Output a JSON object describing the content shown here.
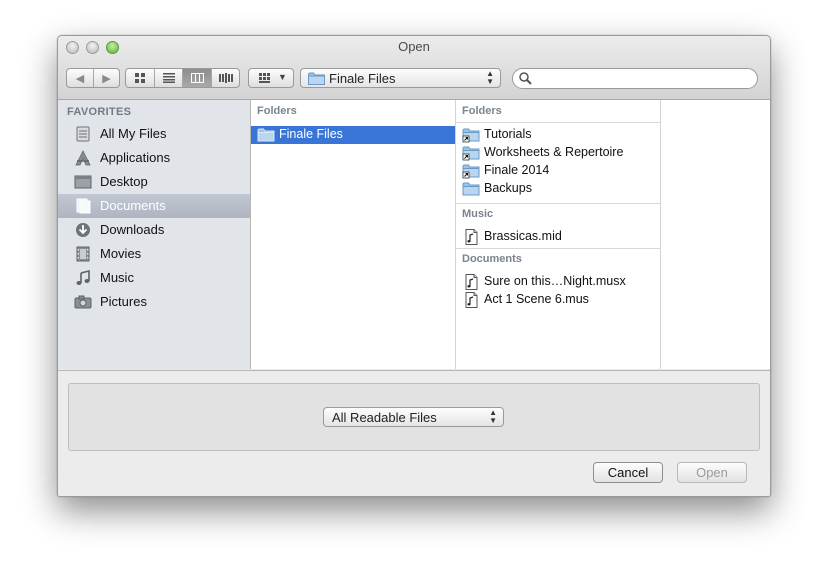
{
  "window": {
    "title": "Open"
  },
  "toolbar": {
    "back_icon": "chevron-left-icon",
    "forward_icon": "chevron-right-icon",
    "views": [
      "icon-view",
      "list-view",
      "column-view",
      "coverflow-view"
    ],
    "active_view": "column-view",
    "arrange_icon": "arrange-grid-icon",
    "path_popup": "Finale Files",
    "search_placeholder": ""
  },
  "sidebar": {
    "heading": "FAVORITES",
    "items": [
      {
        "label": "All My Files",
        "icon": "all-files-icon"
      },
      {
        "label": "Applications",
        "icon": "applications-icon"
      },
      {
        "label": "Desktop",
        "icon": "desktop-icon"
      },
      {
        "label": "Documents",
        "icon": "documents-icon",
        "selected": true
      },
      {
        "label": "Downloads",
        "icon": "downloads-icon"
      },
      {
        "label": "Movies",
        "icon": "movies-icon"
      },
      {
        "label": "Music",
        "icon": "music-icon"
      },
      {
        "label": "Pictures",
        "icon": "pictures-icon"
      }
    ]
  },
  "column1": {
    "heading": "Folders",
    "items": [
      {
        "label": "Finale Files",
        "icon": "folder-icon",
        "selected": true
      }
    ]
  },
  "column2": {
    "groups": [
      {
        "heading": "Folders",
        "items": [
          {
            "label": "Tutorials",
            "icon": "folder-alias-icon"
          },
          {
            "label": "Worksheets & Repertoire",
            "icon": "folder-alias-icon"
          },
          {
            "label": "Finale 2014",
            "icon": "folder-alias-icon"
          },
          {
            "label": "Backups",
            "icon": "folder-icon"
          }
        ]
      },
      {
        "heading": "Music",
        "items": [
          {
            "label": "Brassicas.mid",
            "icon": "music-file-icon"
          }
        ]
      },
      {
        "heading": "Documents",
        "items": [
          {
            "label": "Sure on this…Night.musx",
            "icon": "music-file-icon"
          },
          {
            "label": "Act 1 Scene 6.mus",
            "icon": "music-file-icon"
          }
        ]
      }
    ]
  },
  "bottom": {
    "format_popup": "All Readable Files",
    "cancel_label": "Cancel",
    "open_label": "Open",
    "open_enabled": false
  },
  "colors": {
    "selection": "#3875d7",
    "sidebar_bg": "#e1e5ea",
    "window_bg": "#ececec"
  }
}
